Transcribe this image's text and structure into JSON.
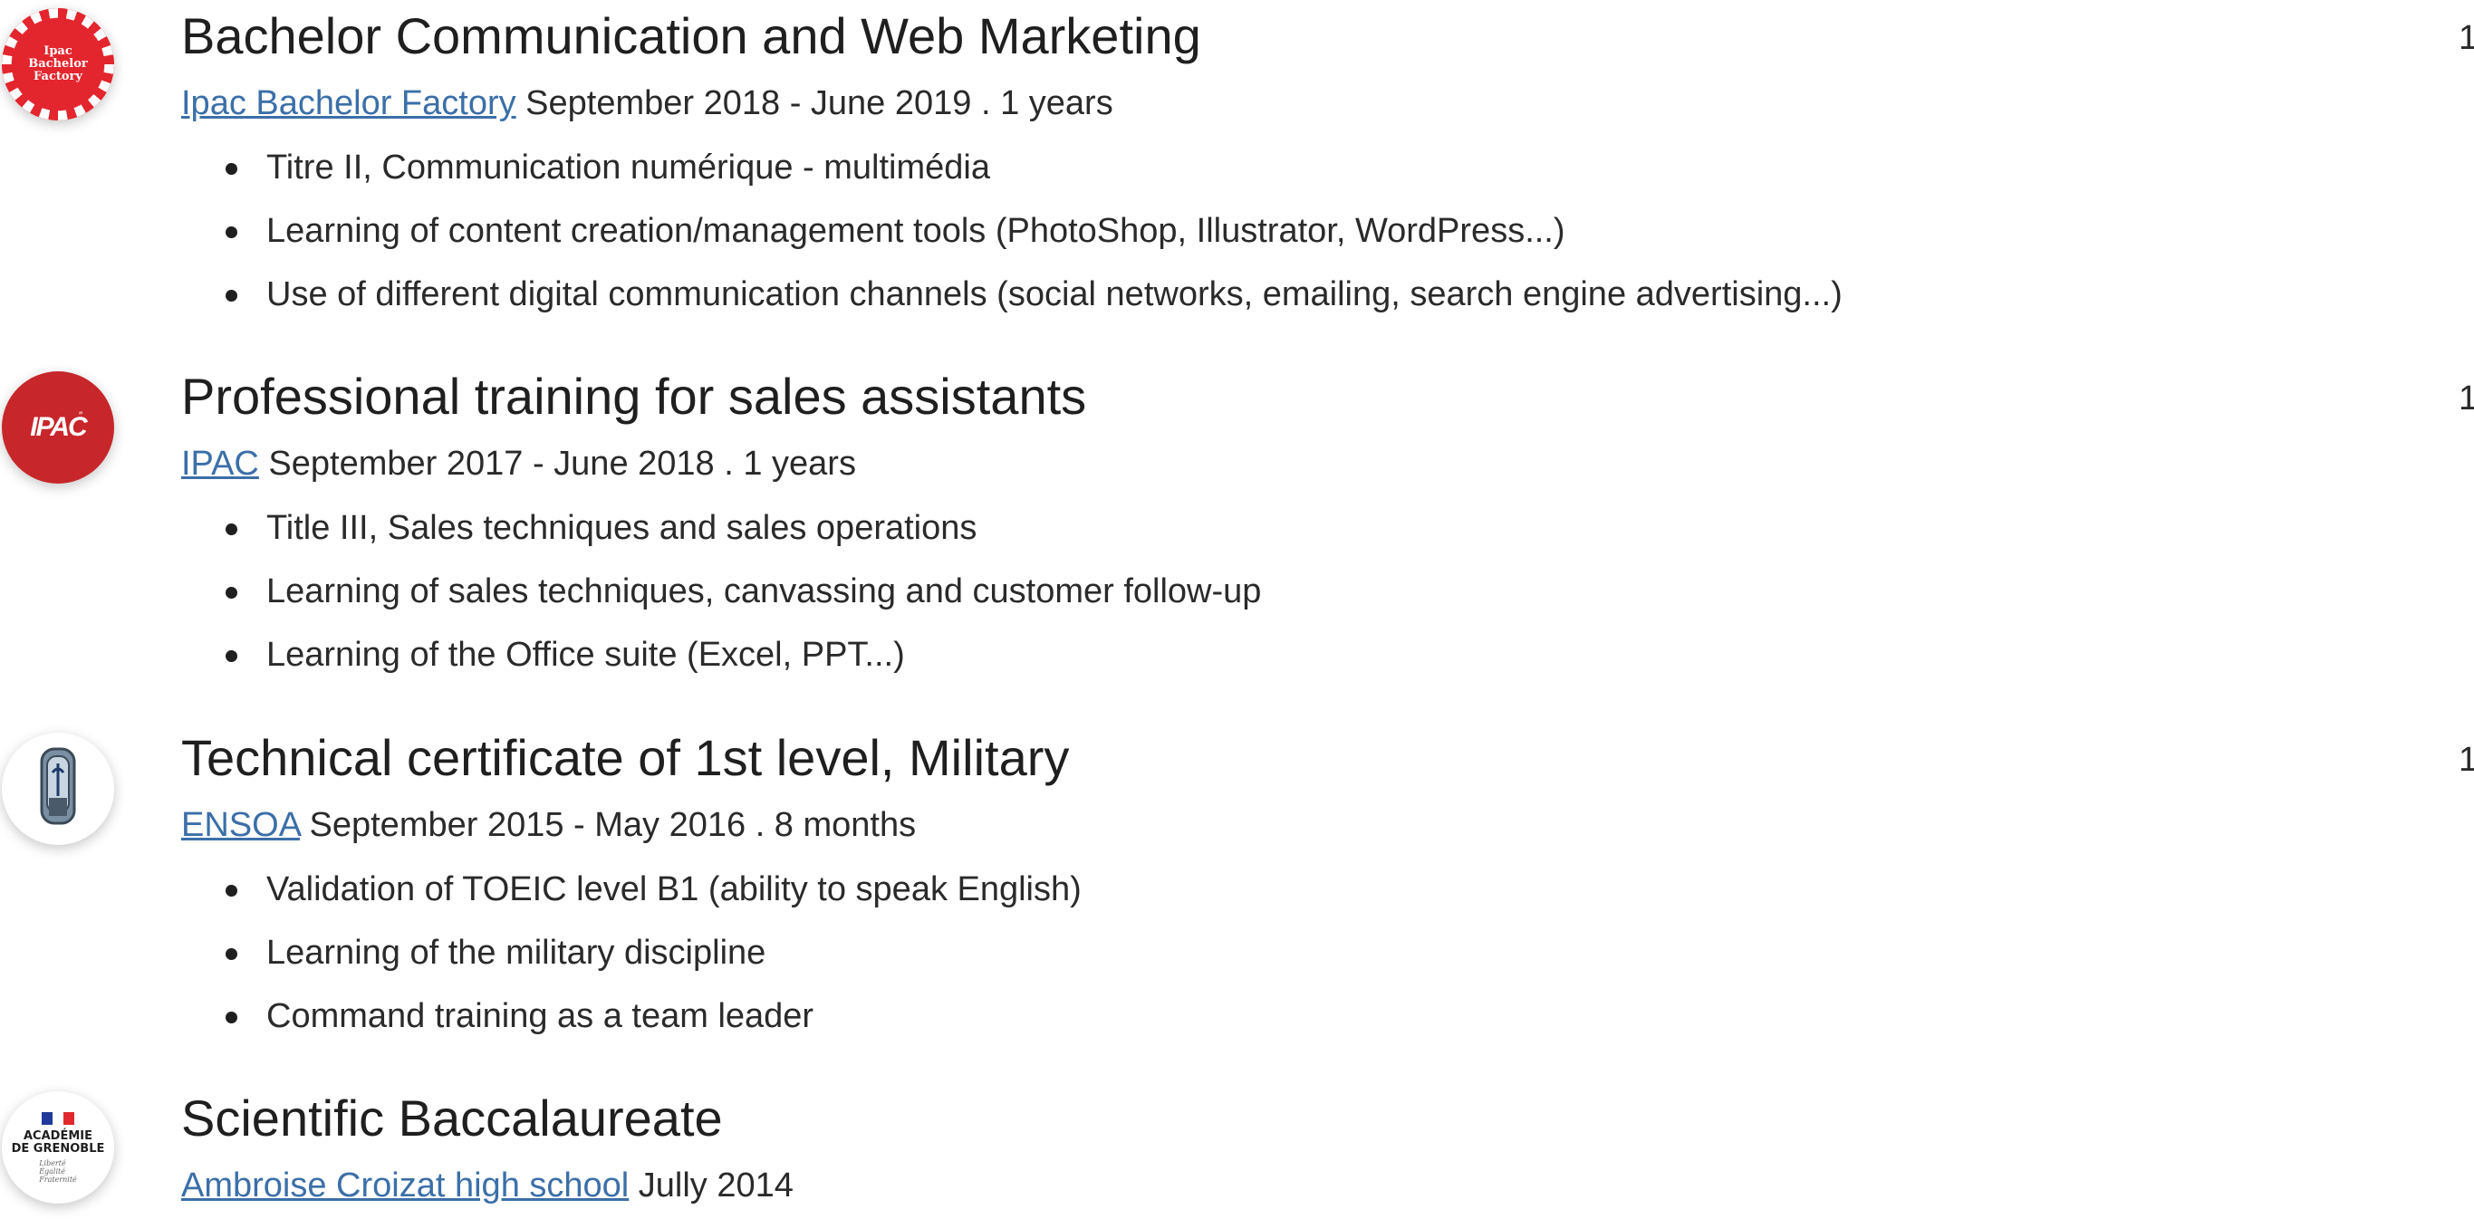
{
  "entries": [
    {
      "title": "Bachelor Communication and Web Marketing",
      "school": "Ipac Bachelor Factory",
      "dates": " September 2018 - June 2019 . 1 years",
      "logo_text": [
        "Ipac",
        "Bachelor",
        "Factory"
      ],
      "logo_icon": "ipac-bachelor-factory-logo-icon",
      "edge_text": "1",
      "bullets": [
        "Titre II, Communication numérique - multimédia",
        "Learning of content creation/management tools (PhotoShop, Illustrator, WordPress...)",
        "Use of different digital communication channels (social networks, emailing, search engine advertising...)"
      ]
    },
    {
      "title": "Professional training for sales assistants",
      "school": "IPAC",
      "dates": " September 2017 - June 2018 . 1 years",
      "logo_text": "IPAC",
      "logo_icon": "ipac-logo-icon",
      "edge_text": "1",
      "bullets": [
        "Title III, Sales techniques and sales operations",
        "Learning of sales techniques, canvassing and customer follow-up",
        "Learning of the Office suite (Excel, PPT...)"
      ]
    },
    {
      "title": "Technical certificate of 1st level, Military",
      "school": "ENSOA",
      "dates": " September 2015 - May 2016 . 8 months",
      "logo_icon": "ensoa-logo-icon",
      "edge_text": "1",
      "bullets": [
        "Validation of TOEIC level B1 (ability to speak English)",
        "Learning of the military discipline",
        "Command training as a team leader"
      ]
    },
    {
      "title": "Scientific Baccalaureate",
      "school": "Ambroise Croizat high school",
      "dates": " Jully 2014",
      "logo_text": [
        "ACADÉMIE",
        "DE GRENOBLE"
      ],
      "logo_motto": [
        "Liberté",
        "Égalité",
        "Fraternité"
      ],
      "logo_icon": "academie-de-grenoble-logo-icon",
      "bullets": []
    }
  ],
  "colors": {
    "link": "#3b6fa8",
    "text": "#1f1f1f",
    "ipac_red": "#c7262a",
    "factory_red": "#e3252d"
  }
}
